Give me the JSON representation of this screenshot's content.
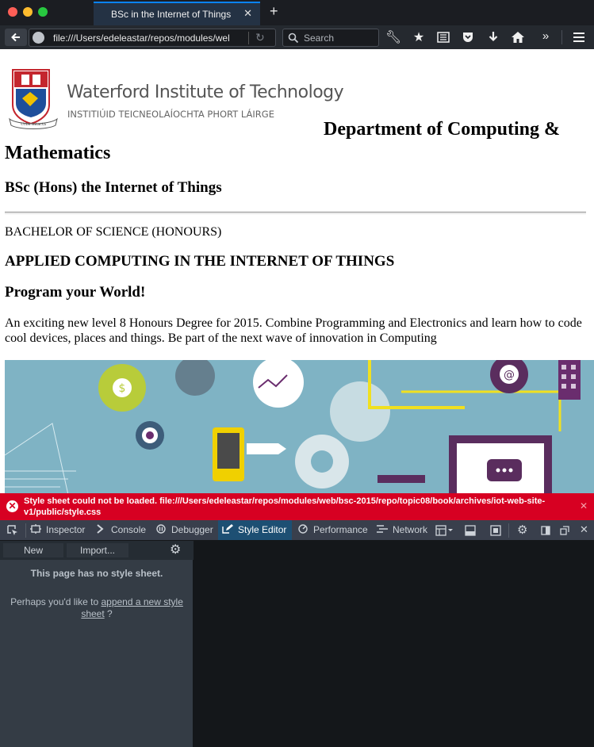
{
  "window": {
    "tab_title": "BSc in the Internet of Things",
    "tab_close": "✕",
    "new_tab": "+"
  },
  "navbar": {
    "url": "file:///Users/edeleastar/repos/modules/web",
    "search_placeholder": "Search"
  },
  "page": {
    "institute_name": "Waterford Institute of Technology",
    "institute_irish": "INSTITIÚID TEICNEOLAÍOCHTA PHORT LÁIRGE",
    "department_line1": "Department of Computing &",
    "department_line2": "Mathematics",
    "degree_title": "BSc (Hons) the Internet of Things",
    "bachelor": "BACHELOR OF SCIENCE (HONOURS)",
    "applied": "APPLIED COMPUTING IN THE INTERNET OF THINGS",
    "program": "Program your World!",
    "description": "An exciting new level 8 Honours Degree for 2015. Combine Programming and Electronics and learn how to code cool devices, places and things. Be part of the next wave of innovation in Computing"
  },
  "error": {
    "message": "Style sheet could not be loaded. file:///Users/edeleastar/repos/modules/web/bsc-2015/repo/topic08/book/archives/iot-web-site-v1/public/style.css",
    "close": "✕"
  },
  "devtools": {
    "tabs": [
      {
        "label": "Inspector"
      },
      {
        "label": "Console"
      },
      {
        "label": "Debugger"
      },
      {
        "label": "Style Editor"
      },
      {
        "label": "Performance"
      },
      {
        "label": "Network"
      }
    ],
    "new_label": "New",
    "import_label": "Import...",
    "no_sheet": "This page has no style sheet.",
    "perhaps": "Perhaps you'd like to ",
    "append_link": "append a new style sheet",
    "perhaps_end": " ?"
  },
  "colors": {
    "error_bar": "#d70022",
    "active_tab": "#1d4f73",
    "banner": "#7fb3c4"
  }
}
